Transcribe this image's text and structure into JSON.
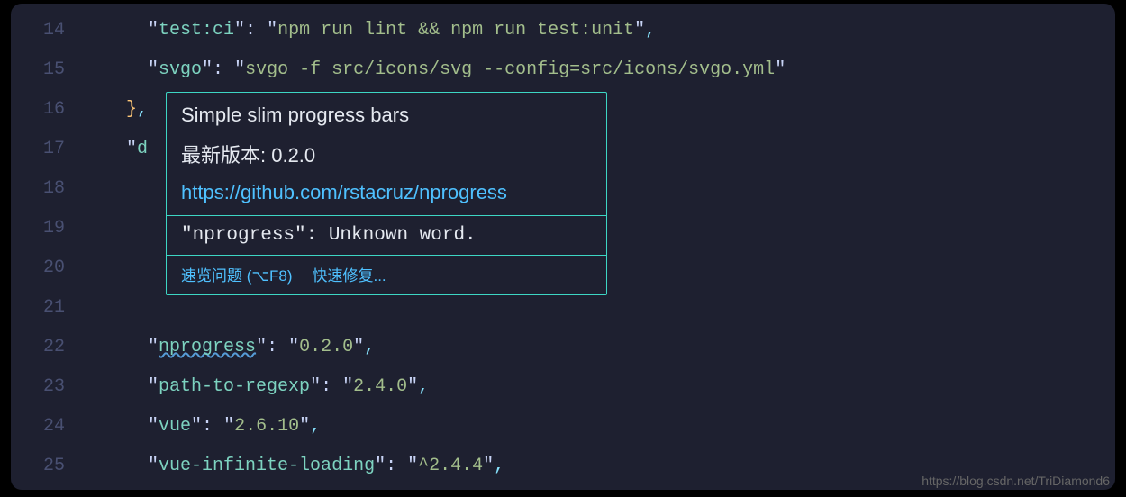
{
  "lines": [
    {
      "num": "14",
      "indent": "      ",
      "tokens": [
        {
          "cls": "s-punct",
          "t": "\""
        },
        {
          "cls": "s-key",
          "t": "test:ci"
        },
        {
          "cls": "s-punct",
          "t": "\": "
        },
        {
          "cls": "s-punct",
          "t": "\""
        },
        {
          "cls": "s-str",
          "t": "npm run lint && npm run test:unit"
        },
        {
          "cls": "s-punct",
          "t": "\""
        },
        {
          "cls": "s-punct-dim",
          "t": ","
        }
      ]
    },
    {
      "num": "15",
      "indent": "      ",
      "tokens": [
        {
          "cls": "s-punct",
          "t": "\""
        },
        {
          "cls": "s-key",
          "t": "svgo"
        },
        {
          "cls": "s-punct",
          "t": "\": "
        },
        {
          "cls": "s-punct",
          "t": "\""
        },
        {
          "cls": "s-str",
          "t": "svgo -f src/icons/svg --config=src/icons/svgo.yml"
        },
        {
          "cls": "s-punct",
          "t": "\""
        }
      ]
    },
    {
      "num": "16",
      "indent": "    ",
      "tokens": [
        {
          "cls": "s-punct-brace",
          "t": "}"
        },
        {
          "cls": "s-punct-dim",
          "t": ","
        }
      ]
    },
    {
      "num": "17",
      "indent": "    ",
      "tokens": [
        {
          "cls": "s-punct",
          "t": "\""
        },
        {
          "cls": "s-key",
          "t": "d"
        }
      ]
    },
    {
      "num": "18",
      "indent": "",
      "tokens": []
    },
    {
      "num": "19",
      "indent": "",
      "tokens": []
    },
    {
      "num": "20",
      "indent": "",
      "tokens": []
    },
    {
      "num": "21",
      "indent": "",
      "tokens": []
    },
    {
      "num": "22",
      "indent": "      ",
      "tokens": [
        {
          "cls": "s-punct",
          "t": "\""
        },
        {
          "cls": "s-key underline-wave",
          "t": "nprogress"
        },
        {
          "cls": "s-punct",
          "t": "\": "
        },
        {
          "cls": "s-punct",
          "t": "\""
        },
        {
          "cls": "s-str",
          "t": "0.2.0"
        },
        {
          "cls": "s-punct",
          "t": "\""
        },
        {
          "cls": "s-punct-dim",
          "t": ","
        }
      ]
    },
    {
      "num": "23",
      "indent": "      ",
      "tokens": [
        {
          "cls": "s-punct",
          "t": "\""
        },
        {
          "cls": "s-key",
          "t": "path-to-regexp"
        },
        {
          "cls": "s-punct",
          "t": "\": "
        },
        {
          "cls": "s-punct",
          "t": "\""
        },
        {
          "cls": "s-str",
          "t": "2.4.0"
        },
        {
          "cls": "s-punct",
          "t": "\""
        },
        {
          "cls": "s-punct-dim",
          "t": ","
        }
      ]
    },
    {
      "num": "24",
      "indent": "      ",
      "tokens": [
        {
          "cls": "s-punct",
          "t": "\""
        },
        {
          "cls": "s-key",
          "t": "vue"
        },
        {
          "cls": "s-punct",
          "t": "\": "
        },
        {
          "cls": "s-punct",
          "t": "\""
        },
        {
          "cls": "s-str",
          "t": "2.6.10"
        },
        {
          "cls": "s-punct",
          "t": "\""
        },
        {
          "cls": "s-punct-dim",
          "t": ","
        }
      ]
    },
    {
      "num": "25",
      "indent": "      ",
      "tokens": [
        {
          "cls": "s-punct",
          "t": "\""
        },
        {
          "cls": "s-key",
          "t": "vue-infinite-loading"
        },
        {
          "cls": "s-punct",
          "t": "\": "
        },
        {
          "cls": "s-punct",
          "t": "\""
        },
        {
          "cls": "s-str",
          "t": "^2.4.4"
        },
        {
          "cls": "s-punct",
          "t": "\""
        },
        {
          "cls": "s-punct-dim",
          "t": ","
        }
      ]
    }
  ],
  "hover": {
    "title": "Simple slim progress bars",
    "version_label": "最新版本: 0.2.0",
    "url": "https://github.com/rstacruz/nprogress",
    "problem": "\"nprogress\": Unknown word.",
    "action_peek": "速览问题 (⌥F8)",
    "action_fix": "快速修复..."
  },
  "watermark": "https://blog.csdn.net/TriDiamond6"
}
